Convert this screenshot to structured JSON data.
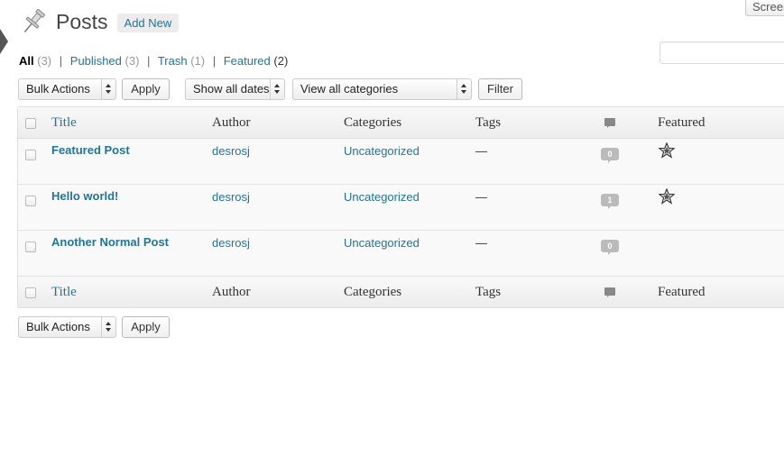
{
  "header": {
    "title": "Posts",
    "add_new_label": "Add New"
  },
  "screen_options_label": "Screen Options",
  "views": [
    {
      "label": "All",
      "count": "(3)",
      "current": true
    },
    {
      "label": "Published",
      "count": "(3)"
    },
    {
      "label": "Trash",
      "count": "(1)"
    },
    {
      "label": "Featured",
      "count": "(2)"
    }
  ],
  "view_separator": "|",
  "tablenav_top": {
    "bulk_actions": "Bulk Actions",
    "apply_label": "Apply",
    "dates_filter": "Show all dates",
    "categories_filter": "View all categories",
    "filter_label": "Filter"
  },
  "tablenav_bottom": {
    "bulk_actions": "Bulk Actions",
    "apply_label": "Apply"
  },
  "columns": {
    "title": "Title",
    "author": "Author",
    "categories": "Categories",
    "tags": "Tags",
    "comments_icon": "comment-icon",
    "featured": "Featured"
  },
  "rows": [
    {
      "title": "Featured Post",
      "author": "desrosj",
      "categories": "Uncategorized",
      "tags": "—",
      "comments": "0",
      "featured": true
    },
    {
      "title": "Hello world!",
      "author": "desrosj",
      "categories": "Uncategorized",
      "tags": "—",
      "comments": "1",
      "featured": true
    },
    {
      "title": "Another Normal Post",
      "author": "desrosj",
      "categories": "Uncategorized",
      "tags": "—",
      "comments": "0",
      "featured": false
    }
  ],
  "colors": {
    "link": "#21759b",
    "text": "#333333",
    "row_bg": "#f9f9f9"
  }
}
